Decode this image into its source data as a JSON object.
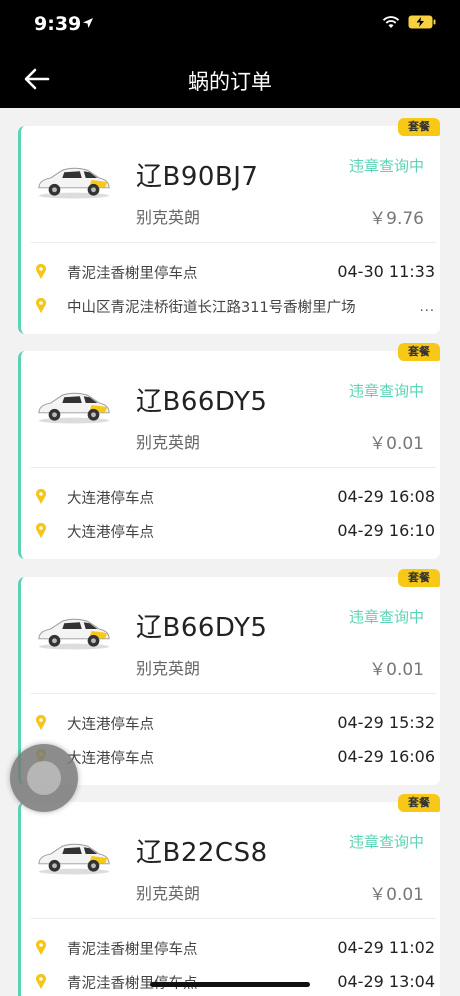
{
  "status_bar": {
    "time": "9:39"
  },
  "header": {
    "title": "蜗的订单"
  },
  "orders": [
    {
      "badge": "套餐",
      "plate": "辽B90BJ7",
      "model": "别克英朗",
      "status": "违章查询中",
      "price": "￥9.76",
      "start_location": "青泥洼香榭里停车点",
      "start_time": "04-30 11:33",
      "end_location": "中山区青泥洼桥街道长江路311号香榭里广场",
      "end_time": "...",
      "accent_color": "#5dd3b5"
    },
    {
      "badge": "套餐",
      "plate": "辽B66DY5",
      "model": "别克英朗",
      "status": "违章查询中",
      "price": "￥0.01",
      "start_location": "大连港停车点",
      "start_time": "04-29 16:08",
      "end_location": "大连港停车点",
      "end_time": "04-29 16:10",
      "accent_color": "#5dd3b5"
    },
    {
      "badge": "套餐",
      "plate": "辽B66DY5",
      "model": "别克英朗",
      "status": "违章查询中",
      "price": "￥0.01",
      "start_location": "大连港停车点",
      "start_time": "04-29 15:32",
      "end_location": "大连港停车点",
      "end_time": "04-29 16:06",
      "accent_color": "#5dd3b5"
    },
    {
      "badge": "套餐",
      "plate": "辽B22CS8",
      "model": "别克英朗",
      "status": "违章查询中",
      "price": "￥0.01",
      "start_location": "青泥洼香榭里停车点",
      "start_time": "04-29 11:02",
      "end_location": "青泥洼香榭里停车点",
      "end_time": "04-29 13:04",
      "accent_color": "#5dd3b5"
    }
  ],
  "colors": {
    "accent": "#5dd3b5",
    "badge": "#f7c916",
    "pin": "#f5c518"
  }
}
